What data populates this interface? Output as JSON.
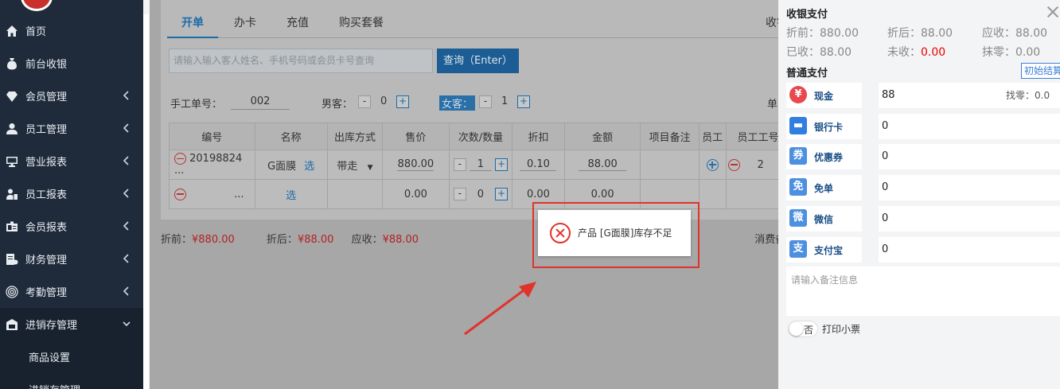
{
  "sidebar": {
    "items": [
      {
        "label": "首页",
        "icon": "home-icon",
        "has_chevron": false
      },
      {
        "label": "前台收银",
        "icon": "money-bag-icon",
        "has_chevron": false
      },
      {
        "label": "会员管理",
        "icon": "diamond-icon",
        "has_chevron": true
      },
      {
        "label": "员工管理",
        "icon": "user-icon",
        "has_chevron": true
      },
      {
        "label": "营业报表",
        "icon": "monitor-icon",
        "has_chevron": true
      },
      {
        "label": "员工报表",
        "icon": "user-report-icon",
        "has_chevron": true
      },
      {
        "label": "会员报表",
        "icon": "id-card-icon",
        "has_chevron": true
      },
      {
        "label": "财务管理",
        "icon": "finance-icon",
        "has_chevron": true
      },
      {
        "label": "考勤管理",
        "icon": "fingerprint-icon",
        "has_chevron": true
      },
      {
        "label": "进销存管理",
        "icon": "warehouse-icon",
        "has_chevron": true,
        "expanded": true
      }
    ],
    "sub_items": [
      {
        "label": "商品设置"
      },
      {
        "label": "进销存管理"
      }
    ]
  },
  "tabs": [
    {
      "label": "开单",
      "active": true
    },
    {
      "label": "办卡"
    },
    {
      "label": "充值"
    },
    {
      "label": "购买套餐"
    }
  ],
  "checkout_label": "收银",
  "search": {
    "placeholder": "请输入输入客人姓名、手机号码或会员卡号查询",
    "button": "查询（Enter）"
  },
  "form": {
    "manual_no_label": "手工单号：",
    "manual_no_value": "002",
    "male_label": "男客：",
    "male_count": "0",
    "female_label": "女客：",
    "female_count": "1",
    "right_label": "单",
    "minus": "-",
    "plus": "+"
  },
  "table": {
    "headers": [
      "编号",
      "名称",
      "出库方式",
      "售价",
      "次数/数量",
      "折扣",
      "金额",
      "项目备注",
      "员工",
      "员工工号"
    ],
    "rows": [
      {
        "code": "20198824 ...",
        "name": "G面膜",
        "select": "选",
        "out_method": "带走",
        "price": "880.00",
        "qty": "1",
        "discount": "0.10",
        "amount": "88.00",
        "staff_no": "2"
      },
      {
        "code": "...",
        "name": "",
        "select": "选",
        "out_method": "",
        "price": "0.00",
        "qty": "0",
        "discount": "0.00",
        "amount": "0.00",
        "staff_no": ""
      }
    ]
  },
  "totals": {
    "before_label": "折前：",
    "before_value": "¥880.00",
    "after_label": "折后：",
    "after_value": "¥88.00",
    "due_label": "应收：",
    "due_value": "¥88.00",
    "remark_label": "消费备注："
  },
  "dialog": {
    "message": "产品 [G面膜]库存不足"
  },
  "payment": {
    "title": "收银支付",
    "summary": [
      {
        "label": "折前：",
        "value": "880.00"
      },
      {
        "label": "折后：",
        "value": "88.00"
      },
      {
        "label": "应收：",
        "value": "88.00"
      },
      {
        "label": "已收：",
        "value": "88.00"
      },
      {
        "label": "未收：",
        "value": "0.00",
        "highlight": true
      },
      {
        "label": "抹零：",
        "value": "0.00"
      }
    ],
    "normal_title": "普通支付",
    "init_button": "初始结算",
    "methods": [
      {
        "name": "现金",
        "icon": "cash-icon",
        "glyph": "¥",
        "color": "#e9484d",
        "value": "88"
      },
      {
        "name": "银行卡",
        "icon": "bank-card-icon",
        "glyph": "▬",
        "color": "#2f7ee0",
        "value": "0"
      },
      {
        "name": "优惠券",
        "icon": "coupon-icon",
        "glyph": "券",
        "color": "#4d8fe0",
        "value": "0"
      },
      {
        "name": "免单",
        "icon": "free-icon",
        "glyph": "免",
        "color": "#4d8fe0",
        "value": "0"
      },
      {
        "name": "微信",
        "icon": "wechat-icon",
        "glyph": "微",
        "color": "#4d8fe0",
        "value": "0"
      },
      {
        "name": "支付宝",
        "icon": "alipay-icon",
        "glyph": "支",
        "color": "#4d8fe0",
        "value": "0"
      }
    ],
    "change_label": "找零：0.0",
    "remark_placeholder": "请输入备注信息",
    "print_toggle": "否",
    "print_label": "打印小票"
  }
}
